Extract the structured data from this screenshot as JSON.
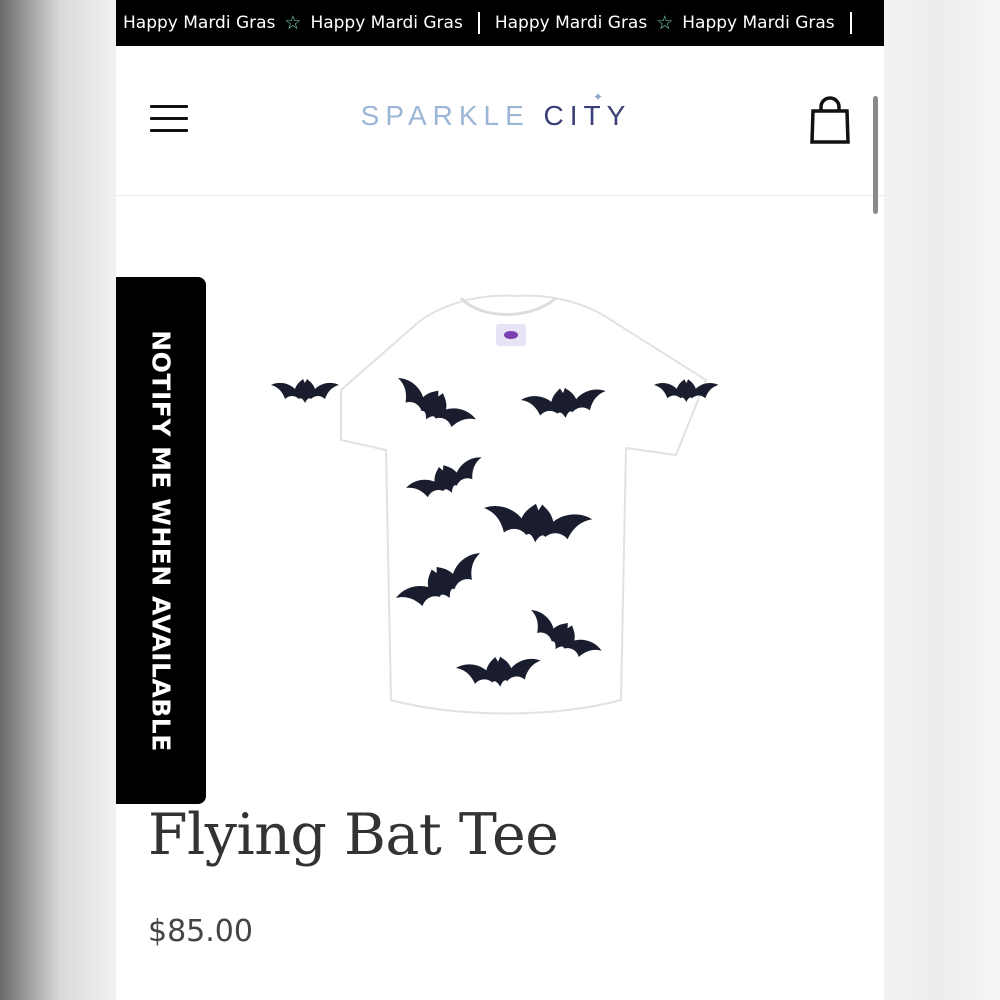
{
  "announcement": {
    "messages": [
      "Happy Mardi Gras",
      "Happy Mardi Gras",
      "Happy Mardi Gras",
      "Happy Mardi Gras"
    ],
    "star_color": "#7fd6b5"
  },
  "header": {
    "logo_word1": "SPARKLE",
    "logo_word2": "CITY",
    "menu_icon": "hamburger-menu-icon",
    "cart_icon": "shopping-bag-icon"
  },
  "notify_button": {
    "label": "NOTIFY ME WHEN AVAILABLE"
  },
  "product": {
    "name": "Flying Bat Tee",
    "price": "$85.00",
    "image_alt": "white t-shirt with sequin bats"
  },
  "colors": {
    "logo_light": "#9cb6d6",
    "logo_dark": "#3a3f7a",
    "text": "#333333"
  }
}
